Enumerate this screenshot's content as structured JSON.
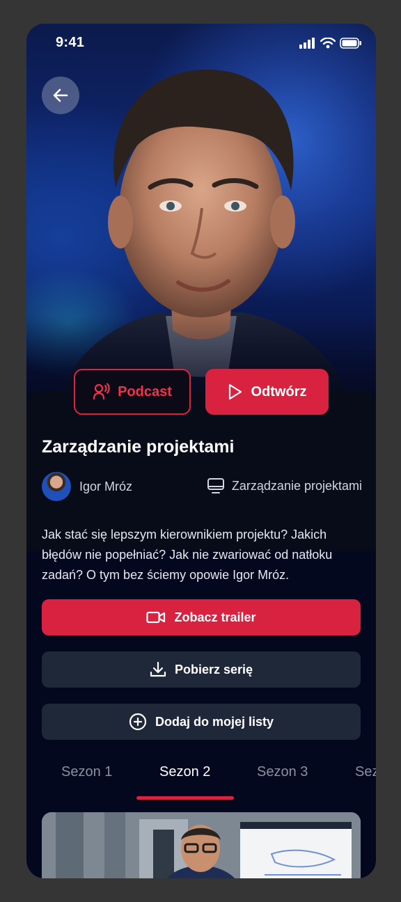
{
  "status": {
    "time": "9:41"
  },
  "hero": {
    "back_icon": "arrow-left-icon"
  },
  "actions": {
    "podcast_label": "Podcast",
    "play_label": "Odtwórz"
  },
  "course": {
    "title": "Zarządzanie projektami",
    "author": "Igor Mróz",
    "category": "Zarządzanie projektami",
    "description": "Jak stać się lepszym kierownikiem projektu? Jakich błędów nie popełniać? Jak nie zwariować od natłoku zadań? O tym bez ściemy opowie Igor Mróz."
  },
  "buttons": {
    "trailer_label": "Zobacz trailer",
    "download_label": "Pobierz serię",
    "mylist_label": "Dodaj do mojej listy"
  },
  "seasons": {
    "items": [
      "Sezon 1",
      "Sezon 2",
      "Sezon 3",
      "Sez"
    ],
    "active_index": 1
  },
  "colors": {
    "accent": "#d8223f",
    "background": "#04081f",
    "secondary_button": "#1f2838"
  }
}
